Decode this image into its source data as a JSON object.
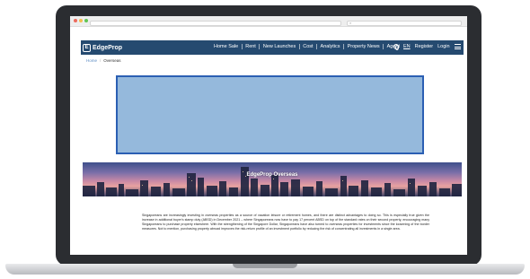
{
  "site": {
    "logo_mark": "E",
    "logo_text": "EdgeProp",
    "menu": [
      "Home Sale",
      "Rent",
      "New Launches",
      "Cost",
      "Analytics",
      "Property News",
      "Agent"
    ],
    "lang": "EN",
    "register": "Register",
    "login": "Login"
  },
  "breadcrumb": {
    "home": "Home",
    "sep": "/",
    "current": "Overseas"
  },
  "banner": {
    "title": "EdgeProp Overseas"
  },
  "body_text": "Singaporeans are increasingly investing in overseas properties as a source of vacation leisure or retirement homes, and there are distinct advantages to doing so. This is especially true given the increase in additional buyer's stamp duty (ABSD) in December 2021 – where Singaporeans now have to pay 17 percent ABSD on top of the standard rates on their second property, encouraging many Singaporeans to purchase property elsewhere. With the strengthening of the Singapore Dollar, Singaporeans have also turned to overseas properties for investments since the loosening of the border measures. Not to mention, purchasing property abroad improves the risk-return profile of an investment portfolio by reducing the risk of concentrating all investments in a single area.",
  "icons": {
    "globe": "globe-icon",
    "menu": "hamburger-menu-icon",
    "search": "search-icon"
  },
  "colors": {
    "header_bg": "#254a70",
    "ad_fill": "#95b9dc",
    "ad_border": "#2b5fb3",
    "link": "#5a8ac2"
  }
}
